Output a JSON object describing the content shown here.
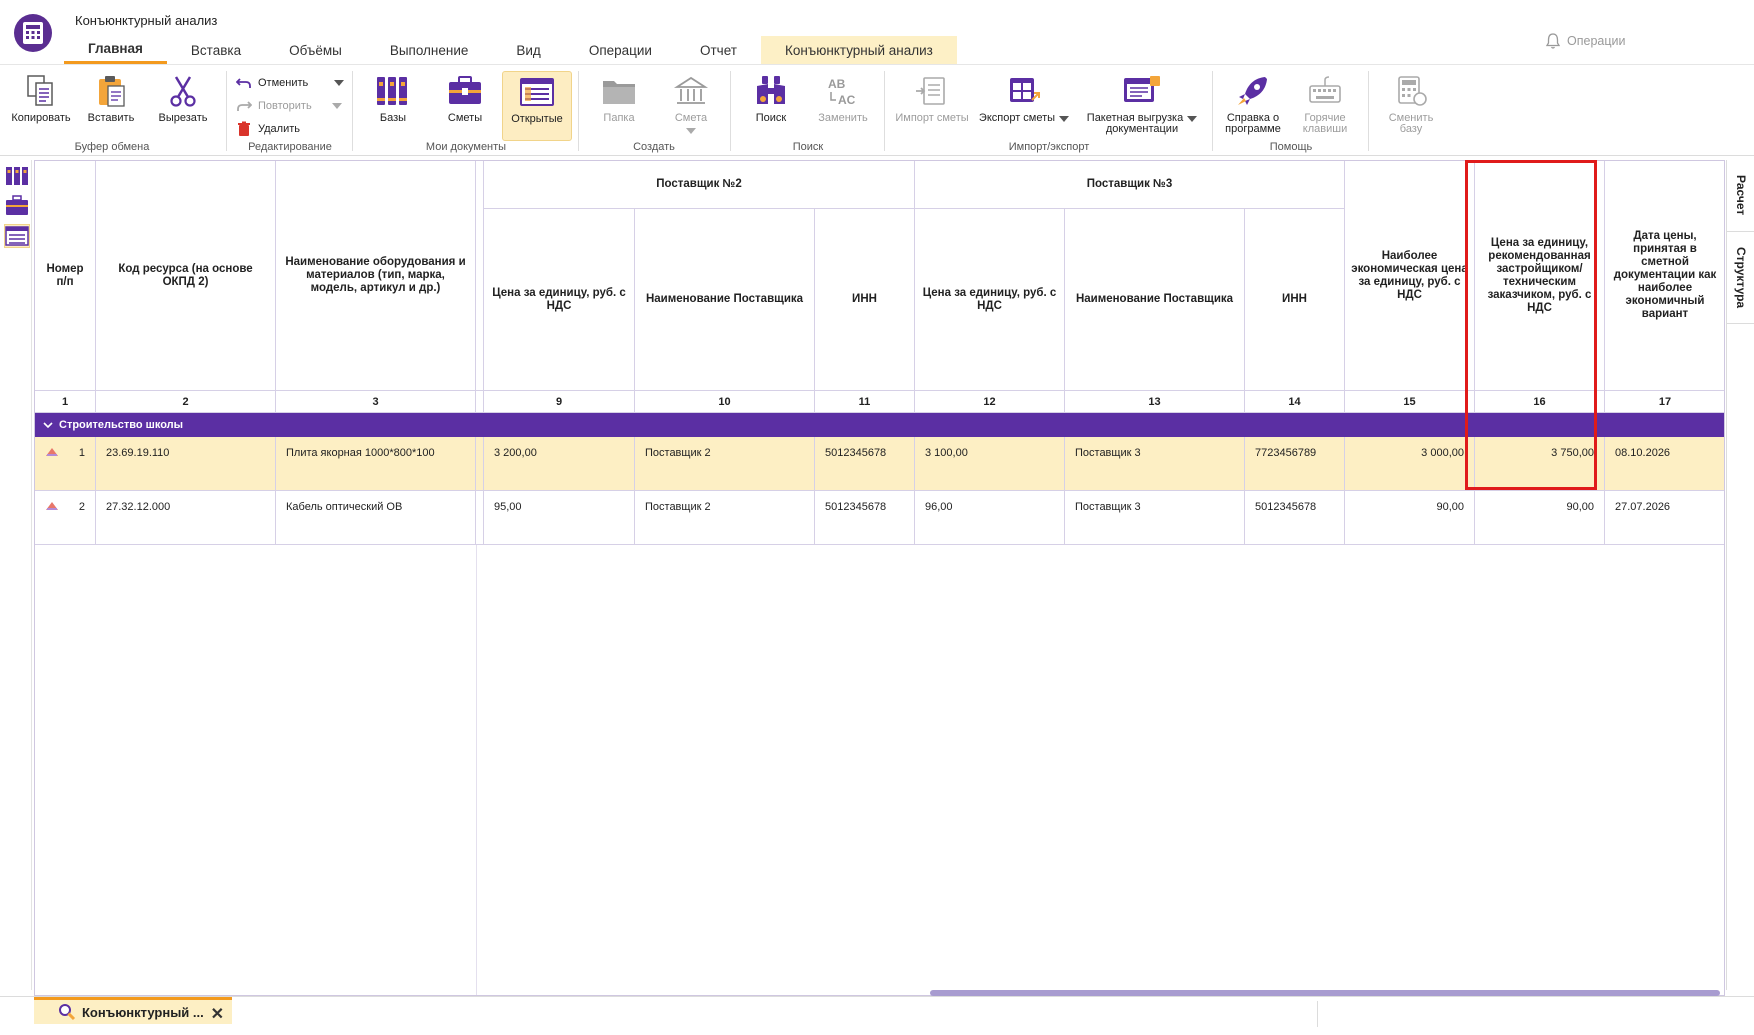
{
  "app": {
    "title": "Конъюнктурный анализ"
  },
  "tabs": [
    {
      "label": "Главная",
      "state": "active"
    },
    {
      "label": "Вставка",
      "state": ""
    },
    {
      "label": "Объёмы",
      "state": ""
    },
    {
      "label": "Выполнение",
      "state": ""
    },
    {
      "label": "Вид",
      "state": ""
    },
    {
      "label": "Операции",
      "state": ""
    },
    {
      "label": "Отчет",
      "state": ""
    },
    {
      "label": "Конъюнктурный анализ",
      "state": "highlight"
    }
  ],
  "ops_search": {
    "label": "Операции"
  },
  "ribbon": {
    "clipboard": {
      "label": "Буфер обмена",
      "copy": "Копировать",
      "paste": "Вставить",
      "cut": "Вырезать"
    },
    "editing": {
      "label": "Редактирование",
      "undo": "Отменить",
      "redo": "Повторить",
      "delete": "Удалить"
    },
    "docs": {
      "label": "Мои документы",
      "bases": "Базы",
      "estimates": "Сметы",
      "opened": "Открытые"
    },
    "create": {
      "label": "Создать",
      "folder": "Папка",
      "estimate": "Смета"
    },
    "search": {
      "label": "Поиск",
      "find": "Поиск",
      "replace": "Заменить"
    },
    "io": {
      "label": "Импорт/экспорт",
      "import": "Импорт сметы",
      "export": "Экспорт сметы",
      "batch1": "Пакетная выгрузка",
      "batch2": "документации"
    },
    "help": {
      "label": "Помощь",
      "about1": "Справка о",
      "about2": "программе",
      "hotkeys1": "Горячие",
      "hotkeys2": "клавиши"
    },
    "base": {
      "switch1": "Сменить",
      "switch2": "базу"
    }
  },
  "right_tabs": {
    "calc": "Расчет",
    "structure": "Структура"
  },
  "grid": {
    "supplier2": "Поставщик №2",
    "supplier3": "Поставщик №3",
    "headers": {
      "num": "Номер п/п",
      "code": "Код ресурса (на основе ОКПД 2)",
      "name": "Наименование оборудования и материалов (тип, марка, модель, артикул и др.)",
      "price2": "Цена за единицу, руб. с НДС",
      "supplier_name2": "Наименование Поставщика",
      "inn2": "ИНН",
      "price3": "Цена за единицу, руб. с НДС",
      "supplier_name3": "Наименование Поставщика",
      "inn3": "ИНН",
      "economic": "Наиболее экономическая цена за единицу, руб. с НДС",
      "recommended": "Цена за единицу, рекомендованная застройщиком/ техническим заказчиком, руб. с НДС",
      "date": "Дата цены, принятая в сметной документации как наиболее экономичный вариант"
    },
    "col_numbers": [
      "1",
      "2",
      "3",
      "9",
      "10",
      "11",
      "12",
      "13",
      "14",
      "15",
      "16",
      "17"
    ],
    "group": "Строительство школы",
    "rows": [
      {
        "num": "1",
        "code": "23.69.19.110",
        "name": "Плита якорная 1000*800*100",
        "price2": "3 200,00",
        "supplier2": "Поставщик 2",
        "inn2": "5012345678",
        "price3": "3 100,00",
        "supplier3": "Поставщик 3",
        "inn3": "7723456789",
        "economic": "3 000,00",
        "recommended": "3 750,00",
        "date": "08.10.2026"
      },
      {
        "num": "2",
        "code": "27.32.12.000",
        "name": "Кабель оптический ОВ",
        "price2": "95,00",
        "supplier2": "Поставщик 2",
        "inn2": "5012345678",
        "price3": "96,00",
        "supplier3": "Поставщик 3",
        "inn3": "5012345678",
        "economic": "90,00",
        "recommended": "90,00",
        "date": "27.07.2026"
      }
    ]
  },
  "doc_tab": {
    "label": "Конъюнктурный ..."
  },
  "colors": {
    "accent": "#5b2fa3",
    "tab_underline": "#f39a1e",
    "row_highlight": "#fdefc4",
    "highlight_box": "#e01b1b"
  }
}
